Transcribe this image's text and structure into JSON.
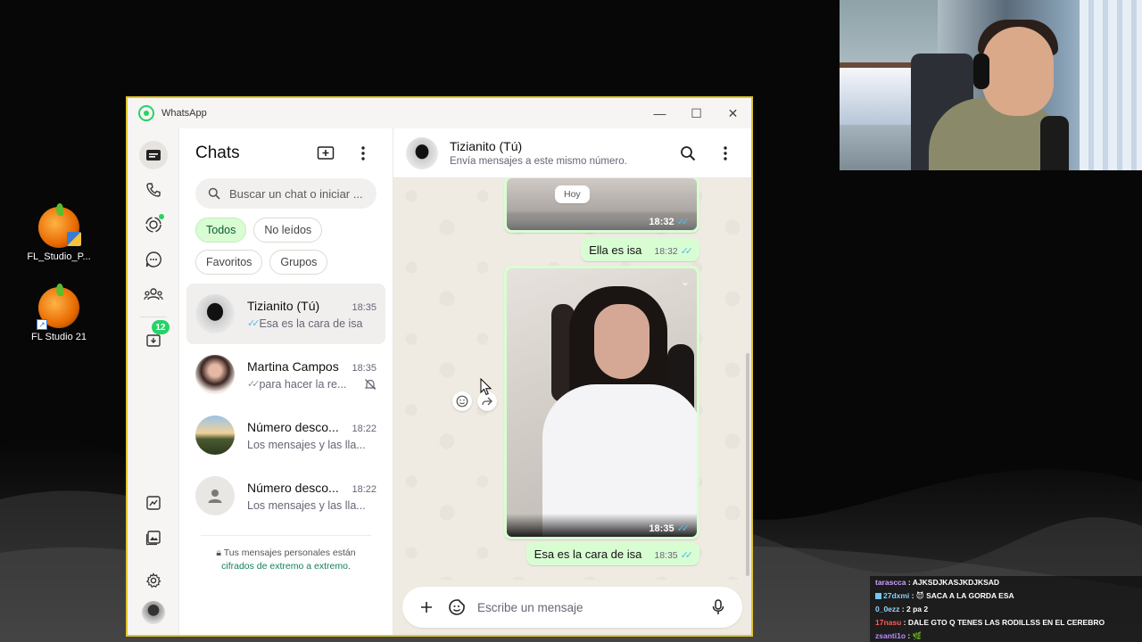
{
  "desktop": {
    "icons": [
      {
        "label": "FL_Studio_P..."
      },
      {
        "label": "FL Studio 21"
      }
    ]
  },
  "window": {
    "title": "WhatsApp",
    "controls": {
      "minimize": "—",
      "maximize": "☐",
      "close": "✕"
    }
  },
  "rail": {
    "updates_badge": "12",
    "colors": {
      "accent": "#25d366"
    }
  },
  "chatlist": {
    "title": "Chats",
    "search_placeholder": "Buscar un chat o iniciar ...",
    "filters": [
      "Todos",
      "No leídos",
      "Favoritos",
      "Grupos"
    ],
    "active_filter": "Todos",
    "chats": [
      {
        "name": "Tizianito (Tú)",
        "time": "18:35",
        "preview": "Esa es la cara de isa",
        "ticks": "read"
      },
      {
        "name": "Martina Campos",
        "time": "18:35",
        "preview": "para hacer la re...",
        "ticks": "delivered",
        "muted": true
      },
      {
        "name": "Número desco...",
        "time": "18:22",
        "preview": "Los mensajes y las lla..."
      },
      {
        "name": "Número desco...",
        "time": "18:22",
        "preview": "Los mensajes y las lla..."
      }
    ],
    "encryption": {
      "text": "Tus mensajes personales están ",
      "link": "cifrados de extremo a extremo",
      "end": "."
    }
  },
  "conversation": {
    "name": "Tizianito (Tú)",
    "subtitle": "Envía mensajes a este mismo número.",
    "day_label": "Hoy",
    "messages": [
      {
        "type": "image",
        "time": "18:32"
      },
      {
        "type": "text",
        "text": "Ella es isa",
        "time": "18:32"
      },
      {
        "type": "image",
        "time": "18:35"
      },
      {
        "type": "text",
        "text": "Esa es la cara de isa",
        "time": "18:35"
      }
    ],
    "composer_placeholder": "Escribe un mensaje"
  },
  "stream_chat": [
    {
      "user": "tarascca",
      "text": "AJKSDJKASJKDJKSAD",
      "color": "#c8a2ff"
    },
    {
      "user": "27dxmi",
      "text": "SACA A LA GORDA ESA",
      "color": "#7fd1ff"
    },
    {
      "user": "0_0ezz",
      "text": "2 pa 2",
      "color": "#9ad0ff"
    },
    {
      "user": "17nasu",
      "text": "DALE GTO Q TENES LAS RODILLSS EN EL CEREBRO",
      "color": "#ff5a5a"
    },
    {
      "user": "zsanti1o",
      "text": "",
      "color": "#b98cff"
    }
  ]
}
